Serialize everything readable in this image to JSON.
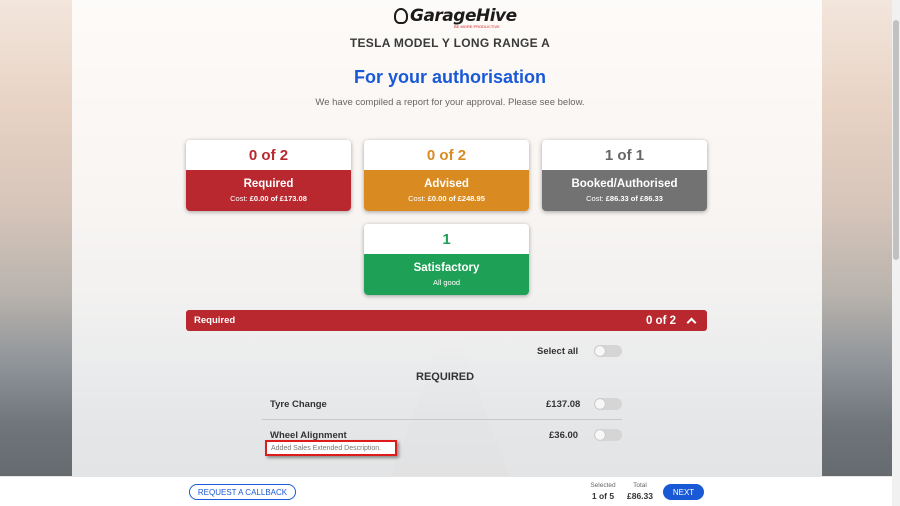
{
  "brand": {
    "name": "GarageHive",
    "tagline": "BE MORE PRODUCTIVE"
  },
  "vehicle": "TESLA MODEL Y LONG RANGE A",
  "heading": "For your authorisation",
  "subtitle": "We have compiled a report for your approval. Please see below.",
  "cards": [
    {
      "count": "0 of 2",
      "title": "Required",
      "cost_label": "Cost:",
      "cost_value": "£0.00 of £173.08",
      "color": "#b8282e",
      "count_color": "#b8282e"
    },
    {
      "count": "0 of 2",
      "title": "Advised",
      "cost_label": "Cost:",
      "cost_value": "£0.00 of £248.95",
      "color": "#d98b22",
      "count_color": "#d98b22"
    },
    {
      "count": "1 of 1",
      "title": "Booked/Authorised",
      "cost_label": "Cost:",
      "cost_value": "£86.33 of £86.33",
      "color": "#727272",
      "count_color": "#666666"
    },
    {
      "count": "1",
      "title": "Satisfactory",
      "sub": "All good",
      "color": "#1ea157",
      "count_color": "#1ea157"
    }
  ],
  "section": {
    "title": "Required",
    "count": "0 of 2"
  },
  "select_all": "Select all",
  "group_heading": "REQUIRED",
  "items": [
    {
      "name": "Tyre Change",
      "price": "£137.08"
    },
    {
      "name": "Wheel Alignment",
      "price": "£36.00",
      "description": "Added Sales Extended Description."
    }
  ],
  "footer": {
    "callback": "REQUEST A CALLBACK",
    "selected_label": "Selected",
    "selected_value": "1 of 5",
    "total_label": "Total",
    "total_value": "£86.33",
    "next": "NEXT"
  }
}
